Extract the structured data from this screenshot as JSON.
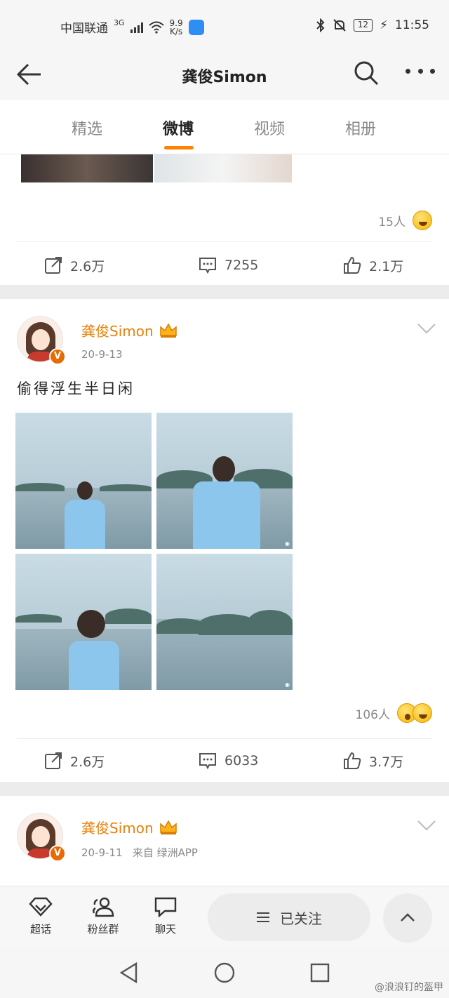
{
  "status_bar": {
    "carrier": "中国联通",
    "network": "3G",
    "speed_value": "9.9",
    "speed_unit": "K/s",
    "battery": "12",
    "time": "11:55"
  },
  "header": {
    "title": "龚俊Simon"
  },
  "tabs": [
    {
      "label": "精选",
      "active": false
    },
    {
      "label": "微博",
      "active": true
    },
    {
      "label": "视频",
      "active": false
    },
    {
      "label": "相册",
      "active": false
    }
  ],
  "prev_post": {
    "reactions_count": "15人",
    "repost": "2.6万",
    "comments": "7255",
    "likes": "2.1万"
  },
  "post1": {
    "author": "龚俊Simon",
    "date": "20-9-13",
    "text": "偷得浮生半日闲",
    "reactions_count": "106人",
    "repost": "2.6万",
    "comments": "6033",
    "likes": "3.7万"
  },
  "post2": {
    "author": "龚俊Simon",
    "date": "20-9-11",
    "source": "来自 绿洲APP"
  },
  "bottom_bar": {
    "supertopic": "超话",
    "fans_group": "粉丝群",
    "chat": "聊天",
    "follow_state": "已关注"
  },
  "watermark": "@浪浪钉的盔甲",
  "colors": {
    "accent": "#ff8200",
    "name": "#e8810c"
  }
}
